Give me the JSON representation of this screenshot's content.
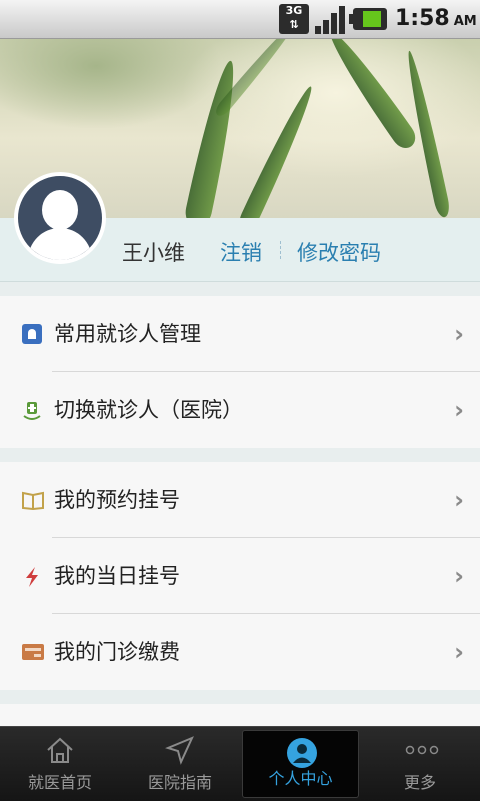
{
  "status_bar": {
    "network": "3G",
    "time": "1:58",
    "ampm": "AM"
  },
  "profile": {
    "username": "王小维",
    "logout": "注销",
    "change_password": "修改密码"
  },
  "menu_groups": [
    {
      "items": [
        {
          "label": "常用就诊人管理",
          "icon": "contacts-icon"
        },
        {
          "label": "切换就诊人（医院）",
          "icon": "switch-hospital-icon"
        }
      ]
    },
    {
      "items": [
        {
          "label": "我的预约挂号",
          "icon": "book-icon"
        },
        {
          "label": "我的当日挂号",
          "icon": "lightning-icon"
        },
        {
          "label": "我的门诊缴费",
          "icon": "card-icon"
        }
      ]
    }
  ],
  "tabs": [
    {
      "label": "就医首页",
      "icon": "home-icon"
    },
    {
      "label": "医院指南",
      "icon": "navigation-arrow-icon"
    },
    {
      "label": "个人中心",
      "icon": "user-icon",
      "active": true
    },
    {
      "label": "更多",
      "icon": "more-dots-icon"
    }
  ],
  "colors": {
    "accent": "#2a7fb0",
    "tab_active": "#35a3e0"
  }
}
